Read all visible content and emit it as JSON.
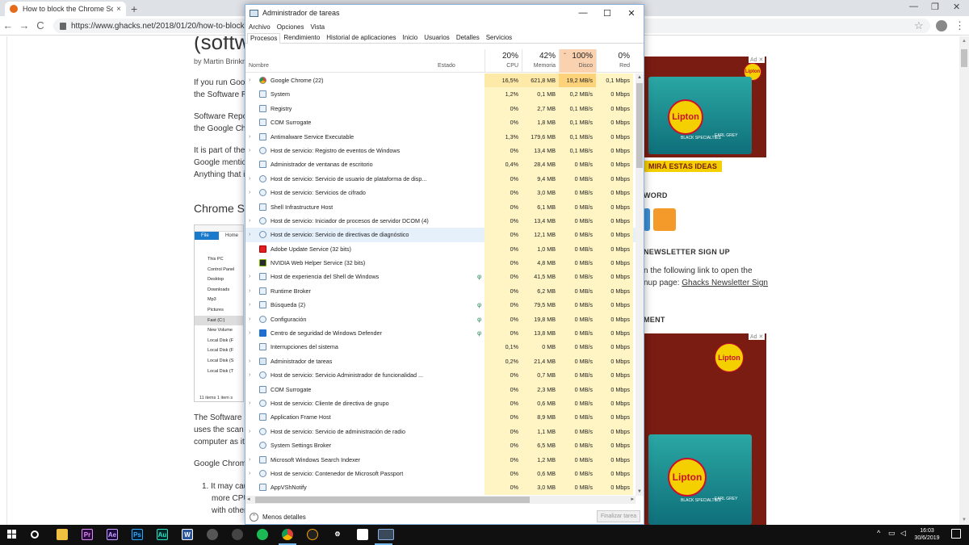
{
  "browser": {
    "tab_title": "How to block the Chrome Softw",
    "tab_close": "×",
    "new_tab": "+",
    "url": "https://www.ghacks.net/2018/01/20/how-to-block-the-",
    "back": "←",
    "forward": "→",
    "reload": "C",
    "star": "☆",
    "menu": "⋮",
    "win_min": "—",
    "win_max": "❐",
    "win_close": "✕"
  },
  "article": {
    "title": "(softw",
    "byline": "by Martin Brinkm",
    "paragraphs": [
      "If you run Goog",
      "the Software R",
      "Software Repo",
      "the Google Chr",
      "It is part of the",
      "Google mention",
      "Anything that in"
    ],
    "heading": "Chrome S",
    "image": {
      "file_tab": "File",
      "home_tab": "Home",
      "tree": [
        "This PC",
        "Control Panel",
        "Desktop",
        "Downloads",
        "Mp3",
        "Pictures",
        "Fast (C:)",
        "New Volume",
        "Local Disk (F",
        "Local Disk (F",
        "Local Disk (S",
        "Local Disk (T"
      ],
      "status": "11 items     1 item s"
    },
    "paragraphs2": [
      "The Software R",
      "uses the scan r",
      "computer as it r",
      "Google Chrome"
    ],
    "list": [
      "1. It may cau",
      "more CPU",
      "with other"
    ]
  },
  "sidebar": {
    "ad_label": "Ad ✕",
    "ad_brand": "Lipton",
    "ad_variant": "BLACK SPECIALTIES",
    "ad_blend": "EARL GREY",
    "ad_cta": "MIRÁ ESTAS IDEAS",
    "word_heading": "WORD",
    "newsletter_heading": "NEWSLETTER SIGN UP",
    "newsletter_text1": "n the following link to open the",
    "newsletter_text2": "nup page:",
    "newsletter_link": "Ghacks Newsletter Sign",
    "ment_heading": "MENT",
    "colors": {
      "ad_bg": "#7a1c12",
      "rss": "#f39a2b",
      "social": "#3d8fd6"
    }
  },
  "taskmgr": {
    "title": "Administrador de tareas",
    "min": "—",
    "max": "☐",
    "close": "✕",
    "menu": [
      "Archivo",
      "Opciones",
      "Vista"
    ],
    "tabs": [
      "Procesos",
      "Rendimiento",
      "Historial de aplicaciones",
      "Inicio",
      "Usuarios",
      "Detalles",
      "Servicios"
    ],
    "columns": {
      "name": "Nombre",
      "state": "Estado",
      "cpu_pct": "20%",
      "cpu": "CPU",
      "mem_pct": "42%",
      "mem": "Memoria",
      "disk_pct": "100%",
      "disk": "Disco",
      "net_pct": "0%",
      "net": "Red",
      "sort": "⌄"
    },
    "rows": [
      {
        "exp": "›",
        "name": "Google Chrome (22)",
        "state": "",
        "cpu": "16,5%",
        "mem": "621,8 MB",
        "disk": "19,2 MB/s",
        "net": "0,1 Mbps",
        "icon": "chrome-icon"
      },
      {
        "exp": "",
        "name": "System",
        "state": "",
        "cpu": "1,2%",
        "mem": "0,1 MB",
        "disk": "0,2 MB/s",
        "net": "0 Mbps",
        "icon": "window-icon"
      },
      {
        "exp": "",
        "name": "Registry",
        "state": "",
        "cpu": "0%",
        "mem": "2,7 MB",
        "disk": "0,1 MB/s",
        "net": "0 Mbps",
        "icon": "window-icon"
      },
      {
        "exp": "",
        "name": "COM Surrogate",
        "state": "",
        "cpu": "0%",
        "mem": "1,8 MB",
        "disk": "0,1 MB/s",
        "net": "0 Mbps",
        "icon": "window-icon"
      },
      {
        "exp": "›",
        "name": "Antimalware Service Executable",
        "state": "",
        "cpu": "1,3%",
        "mem": "179,6 MB",
        "disk": "0,1 MB/s",
        "net": "0 Mbps",
        "icon": "window-icon"
      },
      {
        "exp": "›",
        "name": "Host de servicio: Registro de eventos de Windows",
        "state": "",
        "cpu": "0%",
        "mem": "13,4 MB",
        "disk": "0,1 MB/s",
        "net": "0 Mbps",
        "icon": "gear-icon"
      },
      {
        "exp": "",
        "name": "Administrador de ventanas de escritorio",
        "state": "",
        "cpu": "0,4%",
        "mem": "28,4 MB",
        "disk": "0 MB/s",
        "net": "0 Mbps",
        "icon": "window-icon"
      },
      {
        "exp": "›",
        "name": "Host de servicio: Servicio de usuario de plataforma de disp...",
        "state": "",
        "cpu": "0%",
        "mem": "9,4 MB",
        "disk": "0 MB/s",
        "net": "0 Mbps",
        "icon": "gear-icon"
      },
      {
        "exp": "›",
        "name": "Host de servicio: Servicios de cifrado",
        "state": "",
        "cpu": "0%",
        "mem": "3,0 MB",
        "disk": "0 MB/s",
        "net": "0 Mbps",
        "icon": "gear-icon"
      },
      {
        "exp": "",
        "name": "Shell Infrastructure Host",
        "state": "",
        "cpu": "0%",
        "mem": "6,1 MB",
        "disk": "0 MB/s",
        "net": "0 Mbps",
        "icon": "window-icon"
      },
      {
        "exp": "›",
        "name": "Host de servicio: Iniciador de procesos de servidor DCOM (4)",
        "state": "",
        "cpu": "0%",
        "mem": "13,4 MB",
        "disk": "0 MB/s",
        "net": "0 Mbps",
        "icon": "gear-icon"
      },
      {
        "exp": "›",
        "name": "Host de servicio: Servicio de directivas de diagnóstico",
        "state": "",
        "cpu": "0%",
        "mem": "12,1 MB",
        "disk": "0 MB/s",
        "net": "0 Mbps",
        "icon": "gear-icon"
      },
      {
        "exp": "",
        "name": "Adobe Update Service (32 bits)",
        "state": "",
        "cpu": "0%",
        "mem": "1,0 MB",
        "disk": "0 MB/s",
        "net": "0 Mbps",
        "icon": "adobe-icon"
      },
      {
        "exp": "",
        "name": "NVIDIA Web Helper Service (32 bits)",
        "state": "",
        "cpu": "0%",
        "mem": "4,8 MB",
        "disk": "0 MB/s",
        "net": "0 Mbps",
        "icon": "nvidia-icon"
      },
      {
        "exp": "›",
        "name": "Host de experiencia del Shell de Windows",
        "state": "φ",
        "cpu": "0%",
        "mem": "41,5 MB",
        "disk": "0 MB/s",
        "net": "0 Mbps",
        "icon": "window-icon"
      },
      {
        "exp": "›",
        "name": "Runtime Broker",
        "state": "",
        "cpu": "0%",
        "mem": "6,2 MB",
        "disk": "0 MB/s",
        "net": "0 Mbps",
        "icon": "window-icon"
      },
      {
        "exp": "›",
        "name": "Búsqueda (2)",
        "state": "φ",
        "cpu": "0%",
        "mem": "79,5 MB",
        "disk": "0 MB/s",
        "net": "0 Mbps",
        "icon": "search-icon"
      },
      {
        "exp": "›",
        "name": "Configuración",
        "state": "φ",
        "cpu": "0%",
        "mem": "19,8 MB",
        "disk": "0 MB/s",
        "net": "0 Mbps",
        "icon": "gear-icon"
      },
      {
        "exp": "›",
        "name": "Centro de seguridad de Windows Defender",
        "state": "φ",
        "cpu": "0%",
        "mem": "13,8 MB",
        "disk": "0 MB/s",
        "net": "0 Mbps",
        "icon": "shield-icon"
      },
      {
        "exp": "",
        "name": "Interrupciones del sistema",
        "state": "",
        "cpu": "0,1%",
        "mem": "0 MB",
        "disk": "0 MB/s",
        "net": "0 Mbps",
        "icon": "window-icon"
      },
      {
        "exp": "›",
        "name": "Administrador de tareas",
        "state": "",
        "cpu": "0,2%",
        "mem": "21,4 MB",
        "disk": "0 MB/s",
        "net": "0 Mbps",
        "icon": "taskmgr-icon"
      },
      {
        "exp": "›",
        "name": "Host de servicio: Servicio Administrador de funcionalidad ...",
        "state": "",
        "cpu": "0%",
        "mem": "0,7 MB",
        "disk": "0 MB/s",
        "net": "0 Mbps",
        "icon": "gear-icon"
      },
      {
        "exp": "",
        "name": "COM Surrogate",
        "state": "",
        "cpu": "0%",
        "mem": "2,3 MB",
        "disk": "0 MB/s",
        "net": "0 Mbps",
        "icon": "window-icon"
      },
      {
        "exp": "›",
        "name": "Host de servicio: Cliente de directiva de grupo",
        "state": "",
        "cpu": "0%",
        "mem": "0,6 MB",
        "disk": "0 MB/s",
        "net": "0 Mbps",
        "icon": "gear-icon"
      },
      {
        "exp": "",
        "name": "Application Frame Host",
        "state": "",
        "cpu": "0%",
        "mem": "8,9 MB",
        "disk": "0 MB/s",
        "net": "0 Mbps",
        "icon": "window-icon"
      },
      {
        "exp": "›",
        "name": "Host de servicio: Servicio de administración de radio",
        "state": "",
        "cpu": "0%",
        "mem": "1,1 MB",
        "disk": "0 MB/s",
        "net": "0 Mbps",
        "icon": "gear-icon"
      },
      {
        "exp": "",
        "name": "System Settings Broker",
        "state": "",
        "cpu": "0%",
        "mem": "6,5 MB",
        "disk": "0 MB/s",
        "net": "0 Mbps",
        "icon": "gear-icon"
      },
      {
        "exp": "›",
        "name": "Microsoft Windows Search Indexer",
        "state": "",
        "cpu": "0%",
        "mem": "1,2 MB",
        "disk": "0 MB/s",
        "net": "0 Mbps",
        "icon": "search-icon"
      },
      {
        "exp": "›",
        "name": "Host de servicio: Contenedor de Microsoft Passport",
        "state": "",
        "cpu": "0%",
        "mem": "0,6 MB",
        "disk": "0 MB/s",
        "net": "0 Mbps",
        "icon": "gear-icon"
      },
      {
        "exp": "",
        "name": "AppVShNotify",
        "state": "",
        "cpu": "0%",
        "mem": "3,0 MB",
        "disk": "0 MB/s",
        "net": "0 Mbps",
        "icon": "window-icon"
      }
    ],
    "fewer_details": "Menos detalles",
    "end_task": "Finalizar tarea",
    "colors": {
      "cell_bg": "#fff4c4",
      "disk_hot": "#fcd27a",
      "selected": "#e5f0fb"
    }
  },
  "taskbar": {
    "apps": [
      {
        "label": "Pr",
        "color": "#2a0a3e",
        "fg": "#e08ef7"
      },
      {
        "label": "Ae",
        "color": "#1d0a3e",
        "fg": "#c7a3ff"
      },
      {
        "label": "Ps",
        "color": "#001d34",
        "fg": "#31a8ff"
      },
      {
        "label": "Au",
        "color": "#002b2b",
        "fg": "#2fe0c2"
      },
      {
        "label": "W",
        "color": "#2b579a",
        "fg": "#ffffff"
      }
    ],
    "time": "16:03",
    "date": "30/6/2019",
    "tray_up": "^"
  }
}
